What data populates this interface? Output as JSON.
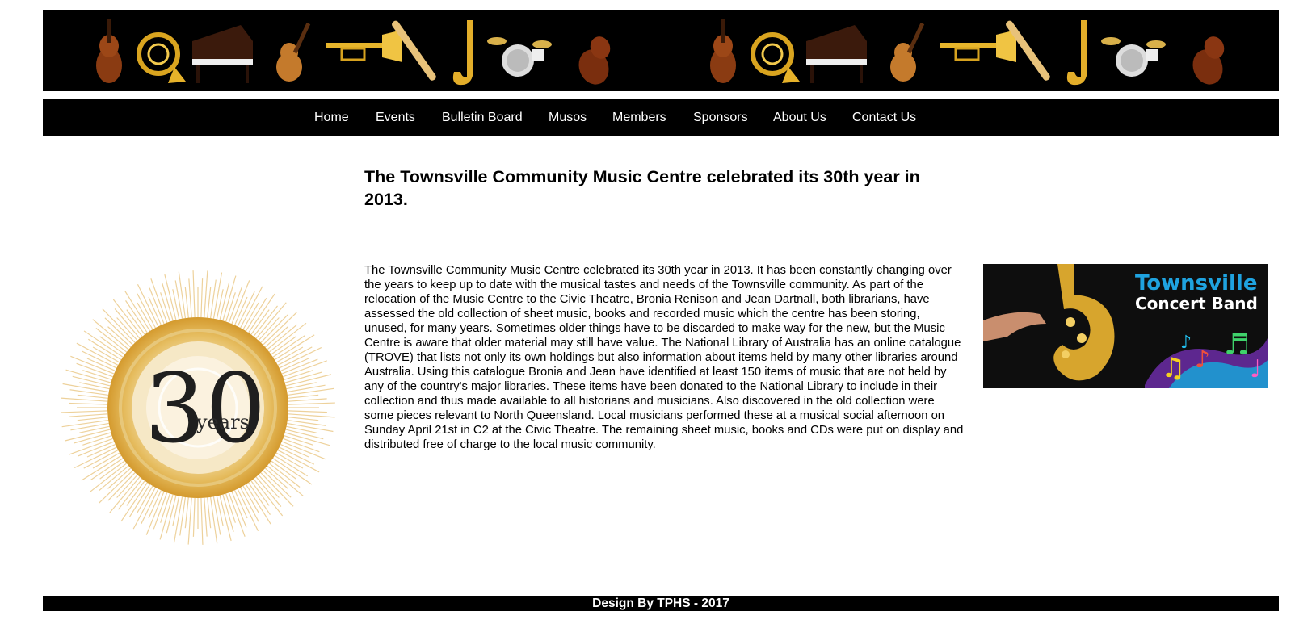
{
  "nav": {
    "items": [
      {
        "label": "Home"
      },
      {
        "label": "Events"
      },
      {
        "label": "Bulletin Board"
      },
      {
        "label": "Musos"
      },
      {
        "label": "Members"
      },
      {
        "label": "Sponsors"
      },
      {
        "label": "About Us"
      },
      {
        "label": "Contact Us"
      }
    ]
  },
  "main": {
    "headline": "The Townsville Community Music Centre celebrated its 30th year in 2013.",
    "body": "The Townsville Community Music Centre celebrated its 30th year in 2013. It has been constantly changing over the years to keep up to date with the musical tastes and needs of the Townsville community. As part of the relocation of the Music Centre to the Civic Theatre, Bronia Renison and Jean Dartnall, both librarians, have assessed the old collection of sheet music, books and recorded music which the centre has been storing, unused, for many years. Sometimes older things have to be discarded to make way for the new, but the Music Centre is aware that older material may still have value. The National Library of Australia has an online catalogue (TROVE) that lists not only its own holdings but also information about items held by many other libraries around Australia. Using this catalogue Bronia and Jean have identified at least 150 items of music that are not held by any of the country's major libraries. These items have been donated to the National Library to include in their collection and thus made available to all historians and musicians. Also discovered in the old collection were some pieces relevant to North Queensland. Local musicians performed these at a musical social afternoon on Sunday April 21st in C2 at the Civic Theatre. The remaining sheet music, books and CDs were put on display and distributed free of charge to the local music community."
  },
  "anniversary_graphic": {
    "number": "30",
    "word": "years"
  },
  "band_ad": {
    "line1": "Townsville",
    "line2": "Concert Band"
  },
  "footer": {
    "text": "Design By TPHS - 2017"
  },
  "colors": {
    "bar_background": "#000000",
    "nav_text": "#ffffff",
    "gold": "#d9a53a",
    "ad_title_blue": "#1fa3e0"
  },
  "icons": [
    "instrument-banner-image",
    "anniversary-30-years-image",
    "saxophone-icon",
    "music-note-icon"
  ]
}
